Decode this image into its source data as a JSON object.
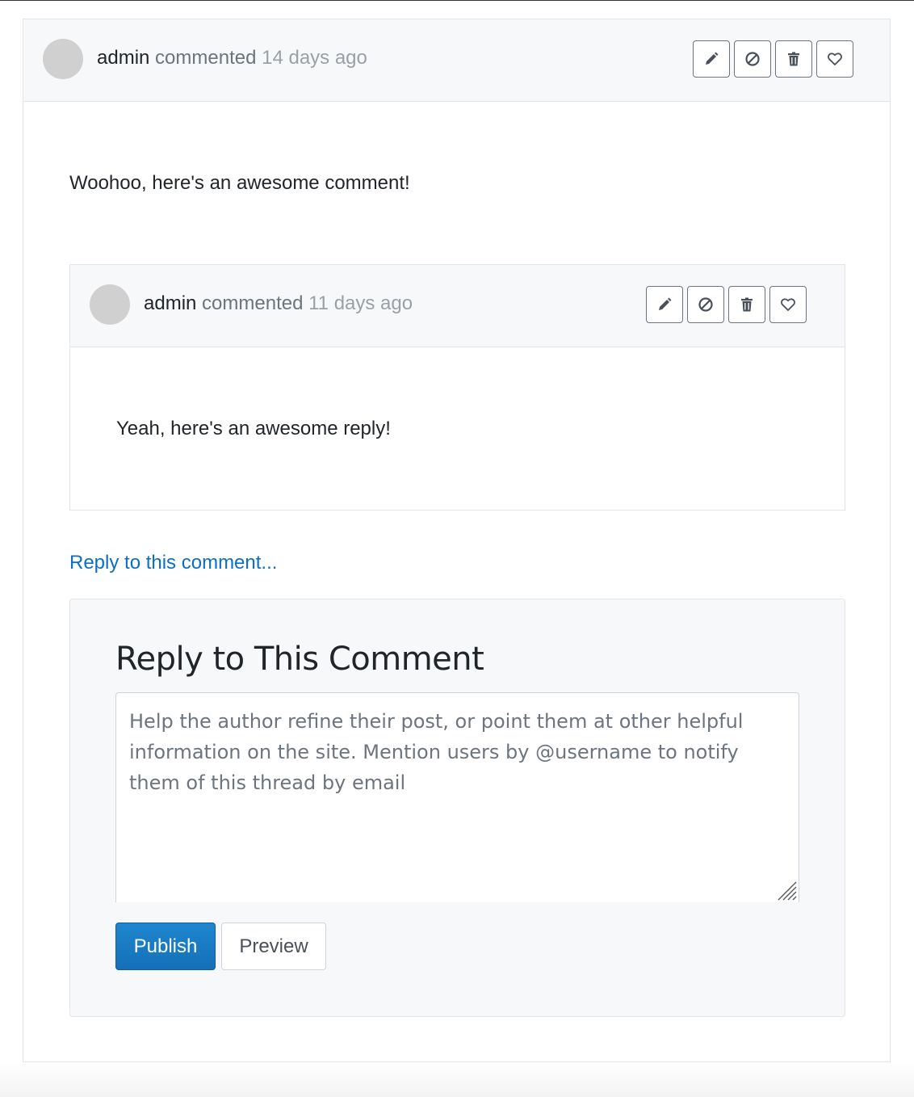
{
  "comment": {
    "author": "admin",
    "verb": "commented",
    "time": "14 days ago",
    "body": "Woohoo, here's an awesome comment!",
    "actions": [
      "edit-icon",
      "block-icon",
      "trash-icon",
      "heart-icon"
    ]
  },
  "reply": {
    "author": "admin",
    "verb": "commented",
    "time": "11 days ago",
    "body": "Yeah, here's an awesome reply!",
    "actions": [
      "edit-icon",
      "block-icon",
      "trash-icon",
      "heart-icon"
    ]
  },
  "reply_link": "Reply to this comment...",
  "reply_form": {
    "title": "Reply to This Comment",
    "placeholder": "Help the author refine their post, or point them at other helpful information on the site. Mention users by @username to notify them of this thread by email",
    "value": "",
    "publish_label": "Publish",
    "preview_label": "Preview"
  },
  "colors": {
    "link": "#0b6ec7",
    "primary": "#1a7bc4",
    "header_bg": "#f7f8fa",
    "avatar": "#d0d0d0"
  }
}
